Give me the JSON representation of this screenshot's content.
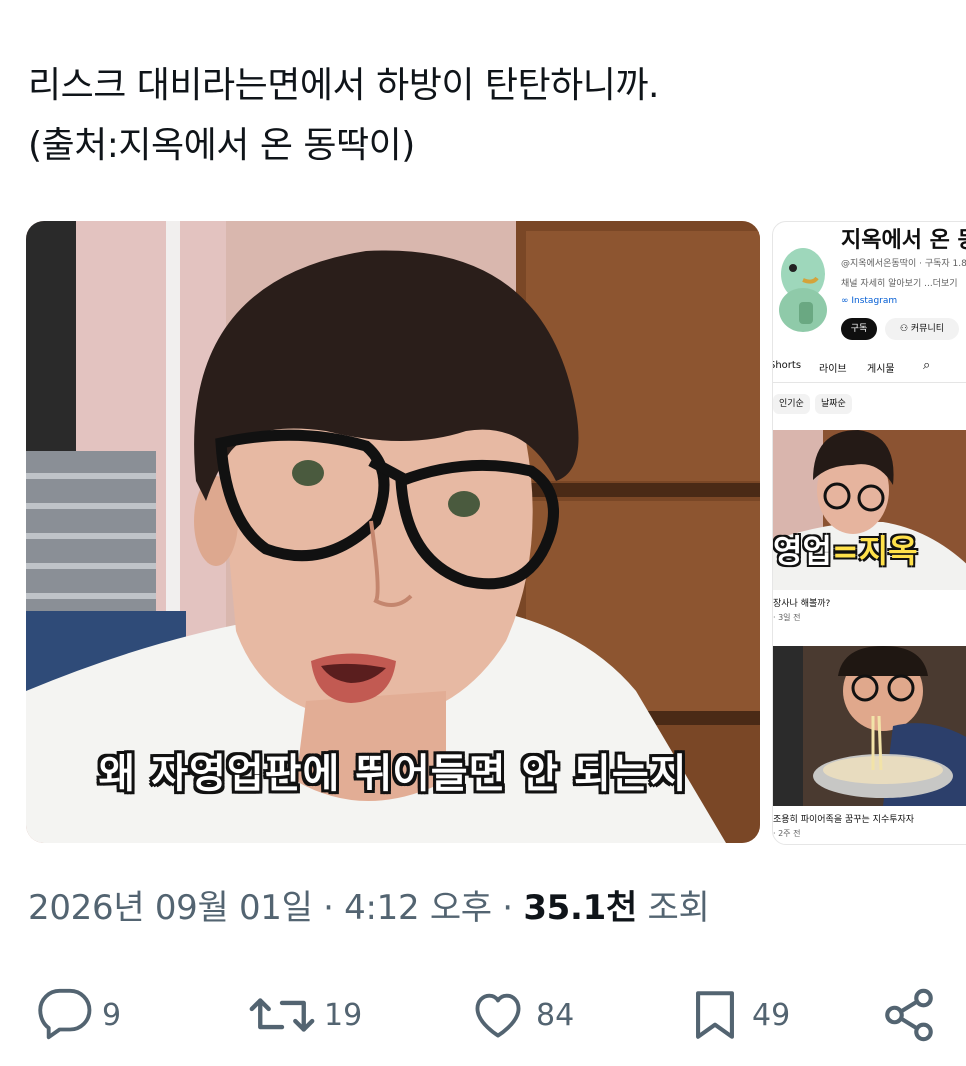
{
  "tweet": {
    "line1": "리스크 대비라는면에서 하방이 탄탄하니까.",
    "line2": "(출처:지옥에서 온 동딱이)"
  },
  "media": {
    "caption": "왜 자영업판에 뛰어들면 안 되는지"
  },
  "yt": {
    "title": "지옥에서 온 동",
    "handle": "@지옥에서온동딱이 · 구독자 1.8",
    "desc": "채널 자세히 알아보기 ...더보기",
    "link": "∞ Instagram",
    "subscribe": "구독",
    "community": "커뮤니티",
    "tabs": [
      "Shorts",
      "라이브",
      "게시물"
    ],
    "chips": [
      "인기순",
      "날짜순"
    ],
    "videos": [
      {
        "caption_a": "영업",
        "caption_b": "=지옥",
        "title": "장사나 해볼까?",
        "meta": "· 3일 전"
      },
      {
        "title": "조용히 파이어족을 꿈꾸는 지수투자자",
        "meta": "· 2주 전"
      }
    ]
  },
  "meta": {
    "date": "2026년 09월 01일",
    "sep1": " · ",
    "time": "4:12 오후",
    "sep2": " · ",
    "views": "35.1천",
    "views_label": " 조회"
  },
  "actions": {
    "reply": "9",
    "retweet": "19",
    "like": "84",
    "bookmark": "49"
  },
  "colors": {
    "text": "#0f1419",
    "muted": "#536471"
  }
}
